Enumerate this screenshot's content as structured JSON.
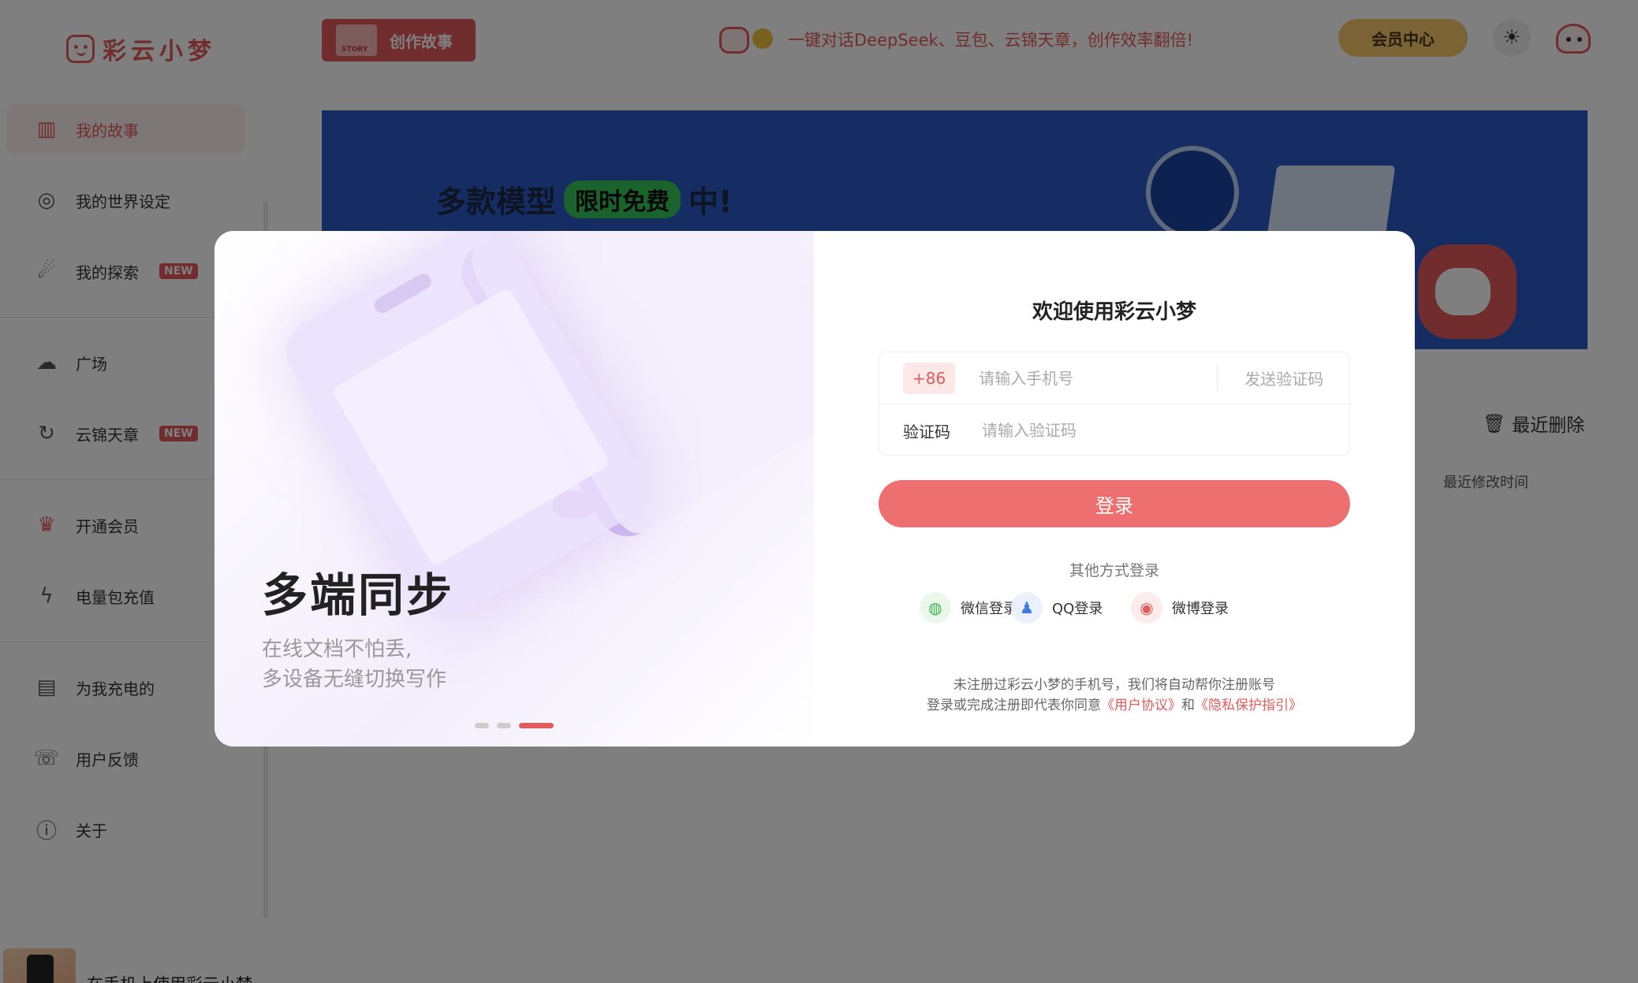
{
  "header": {
    "logo_text": "彩云小梦",
    "create_story_label": "创作故事",
    "promo_text": "一键对话DeepSeek、豆包、云锦天章，创作效率翻倍!",
    "vip_center_label": "会员中心"
  },
  "sidebar": {
    "items": [
      {
        "label": "我的故事",
        "icon": "bookshelf-icon",
        "active": true
      },
      {
        "label": "我的世界设定",
        "icon": "globe-icon"
      },
      {
        "label": "我的探索",
        "icon": "ufo-icon",
        "badge": "NEW"
      },
      {
        "label": "广场",
        "icon": "planet-icon"
      },
      {
        "label": "云锦天章",
        "icon": "swirl-icon",
        "badge": "NEW"
      },
      {
        "label": "开通会员",
        "icon": "crown-icon"
      },
      {
        "label": "电量包充值",
        "icon": "battery-icon"
      },
      {
        "label": "为我充电的",
        "icon": "charge-doc-icon"
      },
      {
        "label": "用户反馈",
        "icon": "feedback-icon"
      },
      {
        "label": "关于",
        "icon": "info-icon"
      }
    ],
    "mobile_prompt": "在手机上使用彩云小梦"
  },
  "main": {
    "banner": {
      "title_prefix": "多款模型",
      "title_tag": "限时免费",
      "title_suffix": "中!"
    },
    "recent_delete_label": "最近删除",
    "recent_modified_label": "最近修改时间"
  },
  "login_modal": {
    "carousel": {
      "title": "多端同步",
      "subtitle_line1": "在线文档不怕丢,",
      "subtitle_line2": "多设备无缝切换写作",
      "active_index": 2,
      "count": 3
    },
    "welcome": "欢迎使用彩云小梦",
    "country_code": "+86",
    "phone_placeholder": "请输入手机号",
    "send_code_label": "发送验证码",
    "code_label": "验证码",
    "code_placeholder": "请输入验证码",
    "login_label": "登录",
    "other_methods_label": "其他方式登录",
    "social": {
      "wechat": "微信登录",
      "qq": "QQ登录",
      "weibo": "微博登录"
    },
    "note_line1": "未注册过彩云小梦的手机号，我们将自动帮你注册账号",
    "note_prefix": "登录或完成注册即代表你同意",
    "agreement_link": "《用户协议》",
    "note_and": "和",
    "privacy_link": "《隐私保护指引》"
  },
  "colors": {
    "brand": "#e25a5a",
    "login_button": "#ed6f6f",
    "banner_bg": "#2c5ac8",
    "vip": "#f4c86a"
  }
}
